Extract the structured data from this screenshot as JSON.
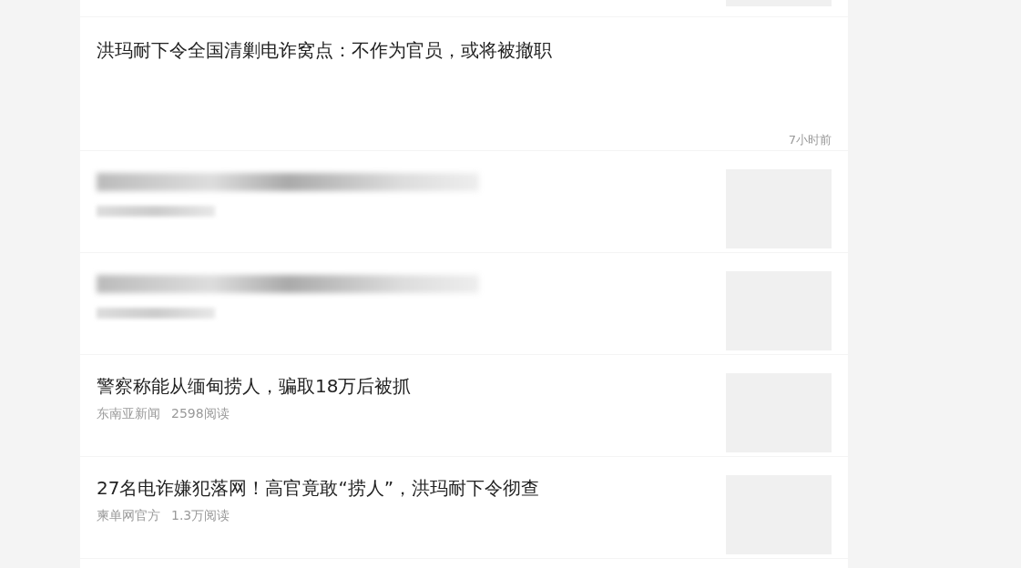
{
  "feed": [
    {
      "kind": "thumb_only"
    },
    {
      "kind": "text_only",
      "title": "洪玛耐下令全国清剿电诈窝点：不作为官员，或将被撤职",
      "time": "7小时前"
    },
    {
      "kind": "blurred"
    },
    {
      "kind": "blurred"
    },
    {
      "kind": "article",
      "title": "警察称能从缅甸捞人，骗取18万后被抓",
      "source": "东南亚新闻",
      "reads": "2598阅读"
    },
    {
      "kind": "article",
      "title": "27名电诈嫌犯落网！高官竟敢“捞人”，洪玛耐下令彻查",
      "source": "柬单网官方",
      "reads": "1.3万阅读"
    }
  ]
}
